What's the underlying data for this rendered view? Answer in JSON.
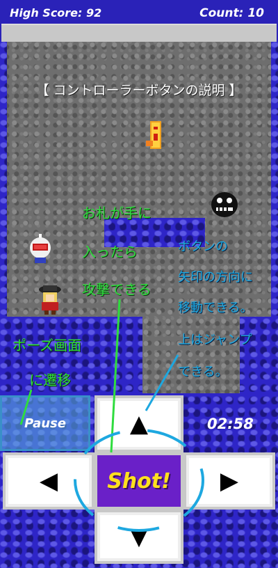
{
  "hud": {
    "high_score": "High Score: 92",
    "count": "Count: 10",
    "progress_fraction": 0.0
  },
  "instructions_title": "【 コントローラーボタンの説明 】",
  "notes": {
    "shot_line1": "お札が手に",
    "shot_line2": "入ったら",
    "shot_line3": "攻撃できる",
    "arrows_line1": "ボタンの",
    "arrows_line2": "矢印の方向に",
    "arrows_line3": "移動できる。",
    "jump_line1": "上はジャンプ",
    "jump_line2": "できる。",
    "pause_line1": "ポーズ画面",
    "pause_line2": "に遷移"
  },
  "controls": {
    "pause_label": "Pause",
    "shot_label": "Shot!",
    "up_icon": "▲",
    "down_icon": "▼",
    "left_icon": "◀",
    "right_icon": "▶"
  },
  "timer": "02:58",
  "colors": {
    "blue_tile": "#2e25c7",
    "gray_tile": "#6e6e6e",
    "shot_button": "#6a20c8",
    "shot_text": "#ffe01e",
    "annotation_green": "#2fdc3e",
    "annotation_blue": "#1ea8e0"
  }
}
